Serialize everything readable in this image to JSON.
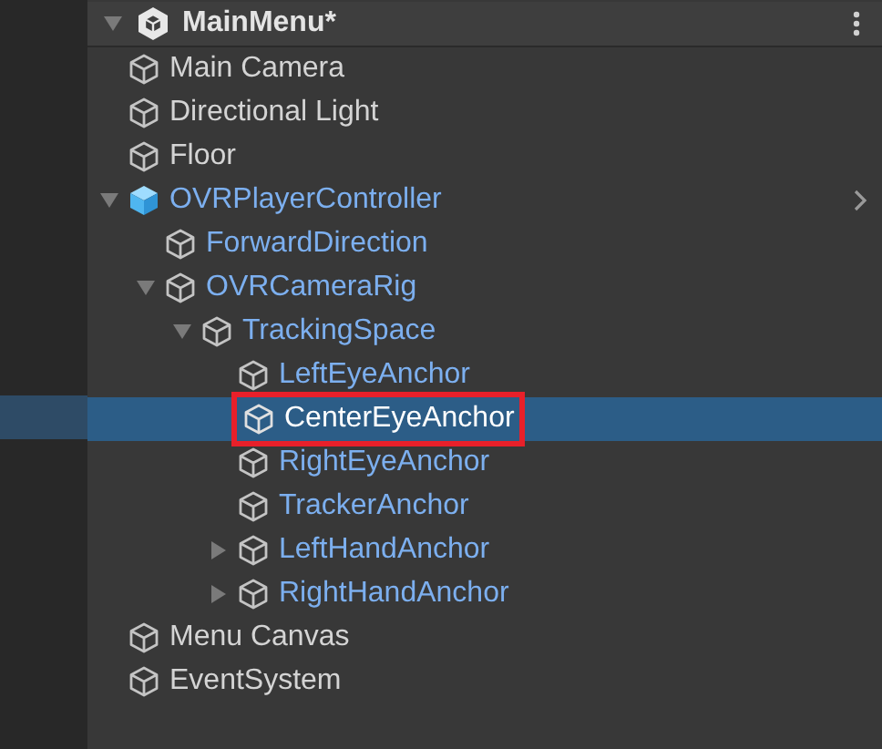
{
  "scene": {
    "title": "MainMenu*",
    "expanded": true
  },
  "items": [
    {
      "name": "Main Camera",
      "kind": "object",
      "selected": false,
      "highlighted": false
    },
    {
      "name": "Directional Light",
      "kind": "object",
      "selected": false,
      "highlighted": false
    },
    {
      "name": "Floor",
      "kind": "object",
      "selected": false,
      "highlighted": false
    },
    {
      "name": "OVRPlayerController",
      "kind": "prefab_root",
      "selected": false,
      "highlighted": false,
      "expanded": true,
      "children": [
        {
          "name": "ForwardDirection",
          "kind": "prefab",
          "selected": false,
          "highlighted": false
        },
        {
          "name": "OVRCameraRig",
          "kind": "prefab",
          "selected": false,
          "highlighted": false,
          "expanded": true,
          "children": [
            {
              "name": "TrackingSpace",
              "kind": "prefab",
              "selected": false,
              "highlighted": false,
              "expanded": true,
              "children": [
                {
                  "name": "LeftEyeAnchor",
                  "kind": "prefab",
                  "selected": false,
                  "highlighted": false
                },
                {
                  "name": "CenterEyeAnchor",
                  "kind": "prefab",
                  "selected": true,
                  "highlighted": true
                },
                {
                  "name": "RightEyeAnchor",
                  "kind": "prefab",
                  "selected": false,
                  "highlighted": false
                },
                {
                  "name": "TrackerAnchor",
                  "kind": "prefab",
                  "selected": false,
                  "highlighted": false
                },
                {
                  "name": "LeftHandAnchor",
                  "kind": "prefab",
                  "selected": false,
                  "highlighted": false,
                  "expanded": false
                },
                {
                  "name": "RightHandAnchor",
                  "kind": "prefab",
                  "selected": false,
                  "highlighted": false,
                  "expanded": false
                }
              ]
            }
          ]
        }
      ]
    },
    {
      "name": "Menu Canvas",
      "kind": "object",
      "selected": false,
      "highlighted": false
    },
    {
      "name": "EventSystem",
      "kind": "object",
      "selected": false,
      "highlighted": false
    }
  ]
}
